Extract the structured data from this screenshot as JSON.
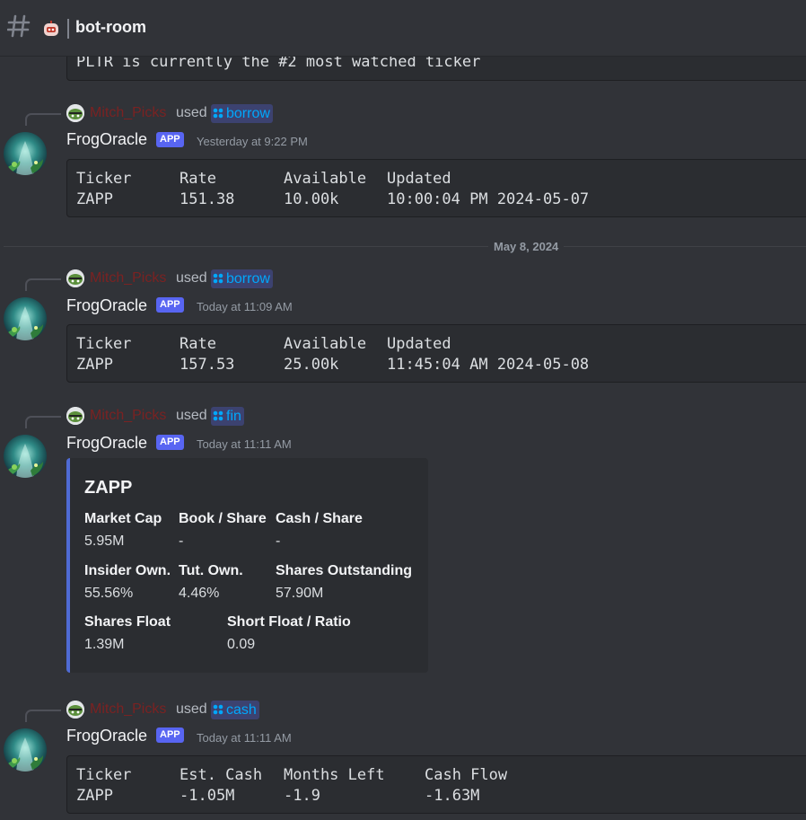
{
  "channel": {
    "name": "bot-room",
    "icon": "hash-icon",
    "bot_icon": "robot-icon"
  },
  "colors": {
    "background": "#313338",
    "codeblock": "#2b2d31",
    "app_badge": "#5865f2",
    "command": "#00a8fc",
    "embed_accent": "#4f6bd4",
    "reply_user": "#7a2222"
  },
  "top_partial": {
    "text": "PLTR is currently the #2 most watched ticker"
  },
  "date_divider": {
    "label": "May 8, 2024"
  },
  "messages": [
    {
      "reply": {
        "user": "Mitch_Picks",
        "used": "used",
        "command": "borrow"
      },
      "author": "FrogOracle",
      "badge": "APP",
      "timestamp": "Yesterday at 9:22 PM",
      "table": {
        "headers": [
          "Ticker",
          "Rate",
          "Available",
          "Updated"
        ],
        "row": [
          "ZAPP",
          "151.38",
          "10.00k",
          "10:00:04 PM 2024-05-07"
        ]
      }
    },
    {
      "reply": {
        "user": "Mitch_Picks",
        "used": "used",
        "command": "borrow"
      },
      "author": "FrogOracle",
      "badge": "APP",
      "timestamp": "Today at 11:09 AM",
      "table": {
        "headers": [
          "Ticker",
          "Rate",
          "Available",
          "Updated"
        ],
        "row": [
          "ZAPP",
          "157.53",
          "25.00k",
          "11:45:04 AM 2024-05-08"
        ]
      }
    },
    {
      "reply": {
        "user": "Mitch_Picks",
        "used": "used",
        "command": "fin"
      },
      "author": "FrogOracle",
      "badge": "APP",
      "timestamp": "Today at 11:11 AM",
      "embed": {
        "title": "ZAPP",
        "fields": [
          {
            "name": "Market Cap",
            "value": "5.95M"
          },
          {
            "name": "Book / Share",
            "value": "-"
          },
          {
            "name": "Cash / Share",
            "value": "-"
          },
          {
            "name": "Insider Own.",
            "value": "55.56%"
          },
          {
            "name": "Tut. Own.",
            "value": "4.46%"
          },
          {
            "name": "Shares Outstanding",
            "value": "57.90M"
          },
          {
            "name": "Shares Float",
            "value": "1.39M"
          },
          {
            "name": "Short Float / Ratio",
            "value": "0.09"
          }
        ]
      }
    },
    {
      "reply": {
        "user": "Mitch_Picks",
        "used": "used",
        "command": "cash"
      },
      "author": "FrogOracle",
      "badge": "APP",
      "timestamp": "Today at 11:11 AM",
      "table": {
        "headers": [
          "Ticker",
          "Est. Cash",
          "Months Left",
          "Cash Flow"
        ],
        "row": [
          "ZAPP",
          "-1.05M",
          "-1.9",
          "-1.63M"
        ]
      }
    }
  ]
}
